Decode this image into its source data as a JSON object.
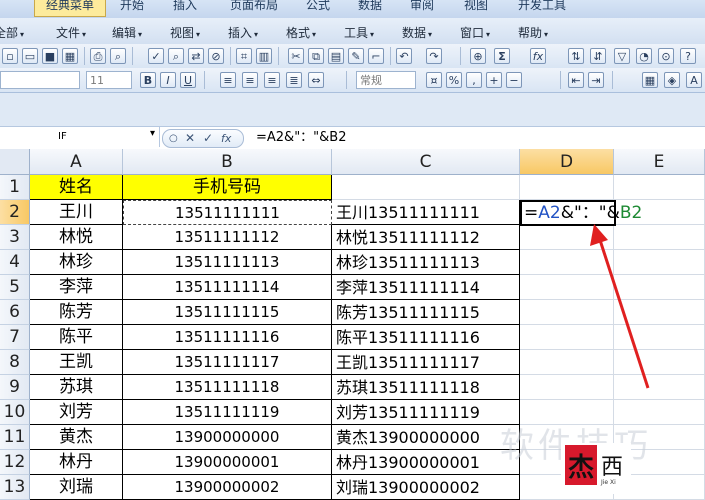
{
  "ribbon_tabs": [
    "经典菜单",
    "开始",
    "插入",
    "页面布局",
    "公式",
    "数据",
    "审阅",
    "视图",
    "开发工具"
  ],
  "menus": [
    "全部",
    "文件",
    "编辑",
    "视图",
    "插入",
    "格式",
    "工具",
    "数据",
    "窗口",
    "帮助"
  ],
  "toolbar": {
    "font_size": "11",
    "style": "常规",
    "sigma": "Σ",
    "fx": "fx"
  },
  "formula_bar": {
    "name_box": "IF",
    "cancel": "✕",
    "enter": "✓",
    "fx": "fx",
    "content": "=A2&\"：\"&B2"
  },
  "columns": [
    "A",
    "B",
    "C",
    "D",
    "E"
  ],
  "rows": [
    {
      "num": "1",
      "a": "姓名",
      "b": "手机号码",
      "c": ""
    },
    {
      "num": "2",
      "a": "王川",
      "b": "13511111111",
      "c": "王川13511111111"
    },
    {
      "num": "3",
      "a": "林悦",
      "b": "13511111112",
      "c": "林悦13511111112"
    },
    {
      "num": "4",
      "a": "林珍",
      "b": "13511111113",
      "c": "林珍13511111113"
    },
    {
      "num": "5",
      "a": "李萍",
      "b": "13511111114",
      "c": "李萍13511111114"
    },
    {
      "num": "6",
      "a": "陈芳",
      "b": "13511111115",
      "c": "陈芳13511111115"
    },
    {
      "num": "7",
      "a": "陈平",
      "b": "13511111116",
      "c": "陈平13511111116"
    },
    {
      "num": "8",
      "a": "王凯",
      "b": "13511111117",
      "c": "王凯13511111117"
    },
    {
      "num": "9",
      "a": "苏琪",
      "b": "13511111118",
      "c": "苏琪13511111118"
    },
    {
      "num": "10",
      "a": "刘芳",
      "b": "13511111119",
      "c": "刘芳13511111119"
    },
    {
      "num": "11",
      "a": "黄杰",
      "b": "13900000000",
      "c": "黄杰13900000000"
    },
    {
      "num": "12",
      "a": "林丹",
      "b": "13900000001",
      "c": "林丹13900000001"
    },
    {
      "num": "13",
      "a": "刘瑞",
      "b": "13900000002",
      "c": "刘瑞13900000002"
    }
  ],
  "edit_cell": {
    "eq": "=",
    "ref_a": "A2",
    "mid": "&\"：\"&",
    "ref_b": "B2"
  },
  "watermark": "软件技巧",
  "logo": {
    "main": "杰",
    "side": "西",
    "sub": "Jie Xi"
  },
  "colors": {
    "accent_yellow": "#ffff00",
    "arrow": "#e02020",
    "ref_a": "#2152c4",
    "ref_b": "#1d8a33"
  }
}
